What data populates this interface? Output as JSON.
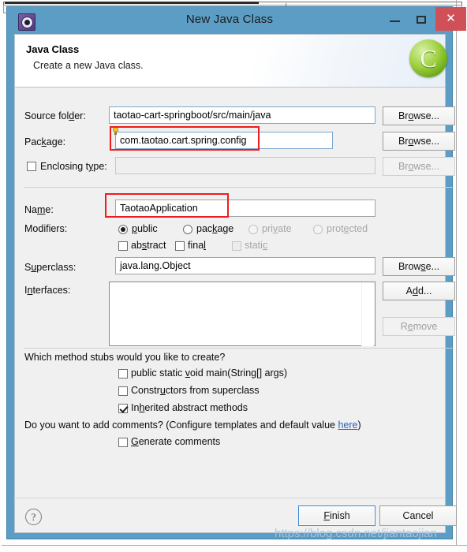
{
  "window": {
    "title": "New Java Class",
    "icon": "gear-icon",
    "controls": {
      "minimize": "–",
      "maximize": "□",
      "close": "✕"
    },
    "close_color": "#d05058",
    "titlebar_color": "#5b9dc4"
  },
  "header": {
    "title": "Java Class",
    "subtitle": "Create a new Java class.",
    "icon": "java-class-green-c-icon",
    "icon_glyph": "C"
  },
  "form": {
    "source_folder": {
      "label": "Source fol",
      "label_mnemonic": "d",
      "label_tail": "er:",
      "value": "taotao-cart-springboot/src/main/java",
      "browse": "Br",
      "browse_mnemonic": "o",
      "browse_tail": "wse..."
    },
    "package": {
      "label": "Pac",
      "label_mnemonic": "k",
      "label_tail": "age:",
      "value": "com.taotao.cart.spring.config",
      "browse": "Br",
      "browse_mnemonic": "o",
      "browse_tail": "wse...",
      "hint_icon": "lightbulb-icon",
      "highlighted": true
    },
    "enclosing_type": {
      "label": "Enclosing t",
      "label_mnemonic": "y",
      "label_tail": "pe:",
      "checked": false,
      "value": "",
      "browse": "Br",
      "browse_mnemonic": "o",
      "browse_tail": "wse...",
      "disabled": true
    },
    "name": {
      "label": "Na",
      "label_mnemonic": "m",
      "label_tail": "e:",
      "value": "TaotaoApplication",
      "highlighted": true
    },
    "modifiers": {
      "label": "Modifiers:",
      "radios": [
        {
          "pre": "",
          "mnemonic": "p",
          "post": "ublic",
          "selected": true,
          "disabled": false
        },
        {
          "pre": "pac",
          "mnemonic": "k",
          "post": "age",
          "selected": false,
          "disabled": false
        },
        {
          "pre": "pri",
          "mnemonic": "v",
          "post": "ate",
          "selected": false,
          "disabled": true
        },
        {
          "pre": "prot",
          "mnemonic": "e",
          "post": "cted",
          "selected": false,
          "disabled": true
        }
      ],
      "checks": [
        {
          "pre": "ab",
          "mnemonic": "s",
          "post": "tract",
          "checked": false,
          "disabled": false
        },
        {
          "pre": "fina",
          "mnemonic": "l",
          "post": "",
          "checked": false,
          "disabled": false
        },
        {
          "pre": "stati",
          "mnemonic": "c",
          "post": "",
          "checked": false,
          "disabled": true
        }
      ]
    },
    "superclass": {
      "label": "S",
      "label_mnemonic": "u",
      "label_tail": "perclass:",
      "value": "java.lang.Object",
      "browse": "Brow",
      "browse_mnemonic": "s",
      "browse_tail": "e..."
    },
    "interfaces": {
      "label": "I",
      "label_mnemonic": "n",
      "label_tail": "terfaces:",
      "items": [],
      "add": "A",
      "add_mnemonic": "d",
      "add_tail": "d...",
      "remove": "R",
      "remove_mnemonic": "e",
      "remove_tail": "move",
      "remove_disabled": true
    }
  },
  "stubs": {
    "question": "Which method stubs would you like to create?",
    "items": [
      {
        "pre": "public static ",
        "mnemonic": "v",
        "post": "oid main(String[] args)",
        "checked": false
      },
      {
        "pre": "Constr",
        "mnemonic": "u",
        "post": "ctors from superclass",
        "checked": false
      },
      {
        "pre": "In",
        "mnemonic": "h",
        "post": "erited abstract methods",
        "checked": true
      }
    ]
  },
  "comments": {
    "question_pre": "Do you want to add comments? (Configure templates and default value ",
    "link": "here",
    "question_post": ")",
    "checkbox": {
      "pre": "",
      "mnemonic": "G",
      "post": "enerate comments",
      "checked": false
    }
  },
  "footer": {
    "help_icon": "help-question-icon",
    "help_glyph": "?",
    "finish": {
      "pre": "",
      "mnemonic": "F",
      "post": "inish",
      "default": true
    },
    "cancel": {
      "pre": "Cancel",
      "mnemonic": "",
      "post": ""
    }
  },
  "watermark": "https://blog.csdn.net/jiantaojian"
}
